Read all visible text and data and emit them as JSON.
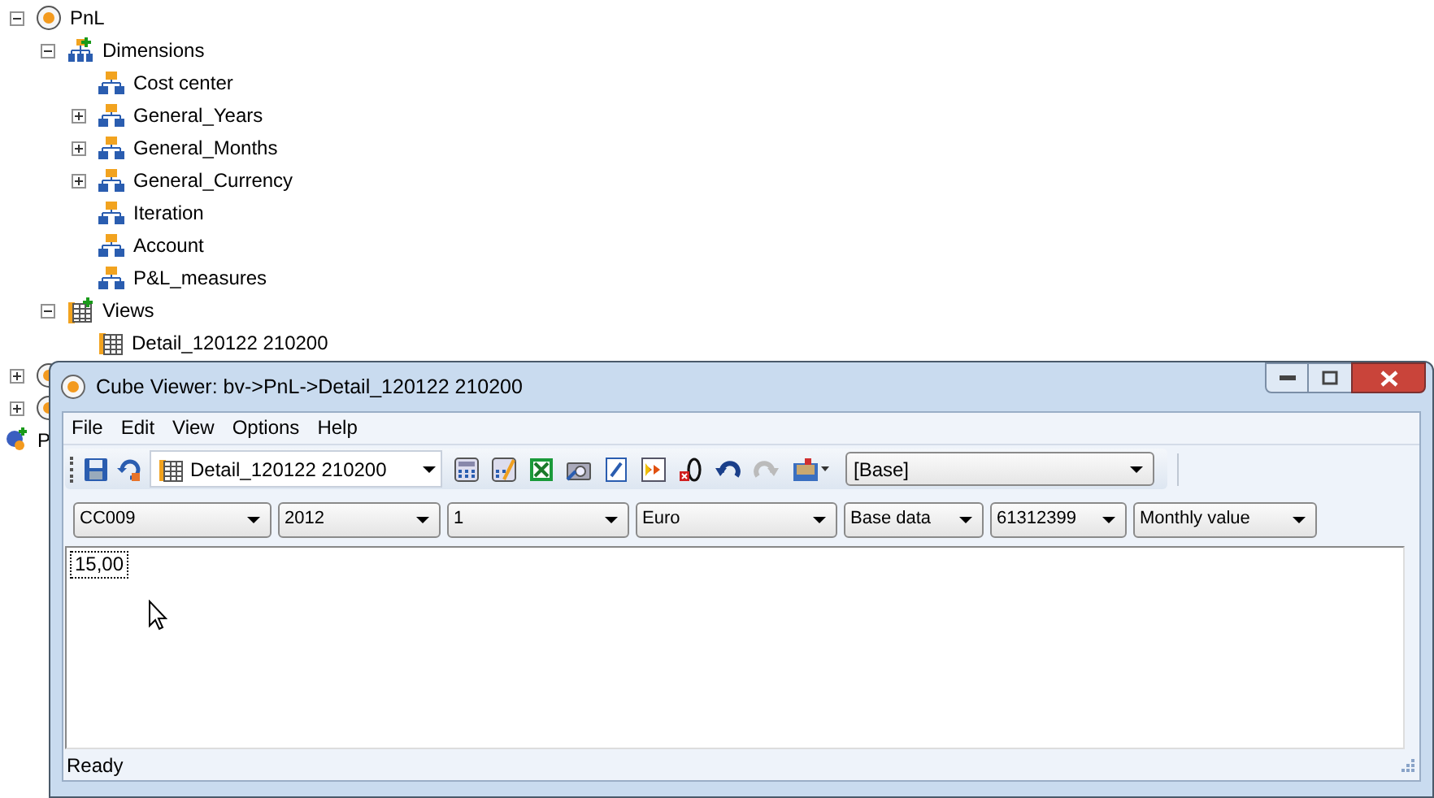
{
  "tree": [
    {
      "label": "PnL",
      "kind": "cube",
      "expanded": true,
      "children": [
        {
          "label": "Dimensions",
          "kind": "dimensions",
          "expanded": true,
          "children": [
            {
              "label": "Cost center",
              "kind": "dimension"
            },
            {
              "label": "General_Years",
              "kind": "dimension",
              "expanded": false
            },
            {
              "label": "General_Months",
              "kind": "dimension",
              "expanded": false
            },
            {
              "label": "General_Currency",
              "kind": "dimension",
              "expanded": false
            },
            {
              "label": "Iteration",
              "kind": "dimension"
            },
            {
              "label": "Account",
              "kind": "dimension"
            },
            {
              "label": "P&L_measures",
              "kind": "dimension"
            }
          ]
        },
        {
          "label": "Views",
          "kind": "views",
          "expanded": true,
          "children": [
            {
              "label": "Detail_120122 210200",
              "kind": "view"
            }
          ]
        }
      ]
    },
    {
      "kind": "cube",
      "expanded": false
    },
    {
      "kind": "cube",
      "expanded": false
    },
    {
      "label": "P",
      "kind": "connection"
    }
  ],
  "window": {
    "title": "Cube Viewer: bv->PnL->Detail_120122 210200",
    "menu": [
      "File",
      "Edit",
      "View",
      "Options",
      "Help"
    ],
    "view_select": "Detail_120122 210200",
    "subset_select": "[Base]",
    "dimension_selects": [
      "CC009",
      "2012",
      "1",
      "Euro",
      "Base data",
      "61312399",
      "Monthly value"
    ],
    "cells": [
      {
        "value": "15,00",
        "focused": true
      }
    ],
    "status": "Ready"
  }
}
